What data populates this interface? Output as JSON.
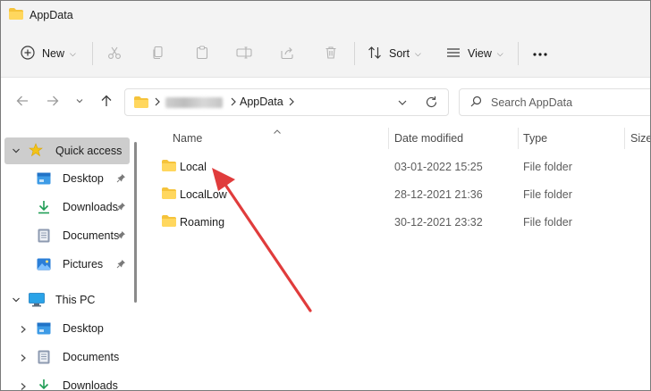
{
  "window": {
    "title": "AppData",
    "accent": "#e03c3c"
  },
  "toolbar": {
    "new_label": "New",
    "sort_label": "Sort",
    "view_label": "View",
    "more_label": "..."
  },
  "address": {
    "crumbs": [
      "AppData"
    ],
    "search_placeholder": "Search AppData"
  },
  "sidebar": {
    "items": [
      {
        "label": "Quick access",
        "icon": "star-icon"
      },
      {
        "label": "Desktop",
        "icon": "desktop-icon"
      },
      {
        "label": "Downloads",
        "icon": "download-icon"
      },
      {
        "label": "Documents",
        "icon": "documents-icon"
      },
      {
        "label": "Pictures",
        "icon": "pictures-icon"
      },
      {
        "label": "This PC",
        "icon": "monitor-icon"
      },
      {
        "label": "Desktop",
        "icon": "desktop-icon"
      },
      {
        "label": "Documents",
        "icon": "documents-icon"
      },
      {
        "label": "Downloads",
        "icon": "download-icon"
      }
    ]
  },
  "columns": {
    "name": "Name",
    "date": "Date modified",
    "type": "Type",
    "size": "Size"
  },
  "files": [
    {
      "name": "Local",
      "date": "03-01-2022 15:25",
      "type": "File folder"
    },
    {
      "name": "LocalLow",
      "date": "28-12-2021 21:36",
      "type": "File folder"
    },
    {
      "name": "Roaming",
      "date": "30-12-2021 23:32",
      "type": "File folder"
    }
  ]
}
